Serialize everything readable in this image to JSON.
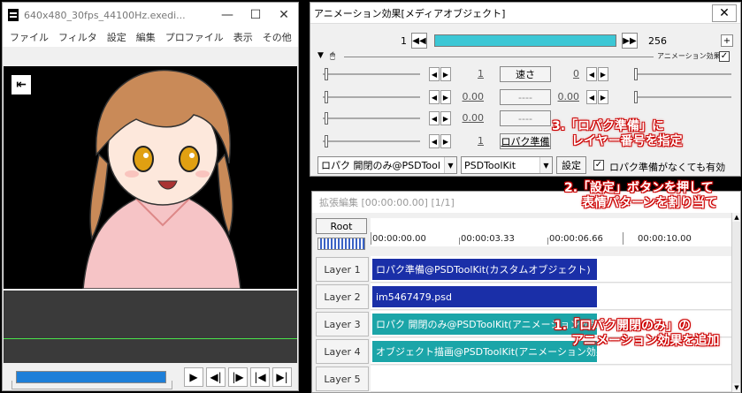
{
  "left_window": {
    "title": "640x480_30fps_44100Hz.exedi...",
    "menu": [
      "ファイル",
      "フィルタ",
      "設定",
      "編集",
      "プロファイル",
      "表示",
      "その他"
    ]
  },
  "anim_window": {
    "title": "アニメーション効果[メディアオブジェクト]",
    "frame_start": "1",
    "frame_end": "256",
    "anim_label": "アニメーション効果",
    "rows": [
      {
        "left_val": "1",
        "button": "速さ",
        "right_val": "0",
        "disabled": false
      },
      {
        "left_val": "0.00",
        "button": "----",
        "right_val": "0.00",
        "disabled": true
      },
      {
        "left_val": "0.00",
        "button": "----",
        "right_val": "",
        "disabled": true
      },
      {
        "left_val": "1",
        "button": "ロパク準備",
        "right_val": "",
        "disabled": false
      }
    ],
    "effect_select": "ロパク 開閉のみ@PSDTool",
    "group_select": "PSDToolKit",
    "settings_button": "設定",
    "checkbox_label": "ロパク準備がなくても有効"
  },
  "timeline": {
    "title": "拡張編集 [00:00:00.00] [1/1]",
    "root": "Root",
    "ruler_labels": [
      "00:00:00.00",
      "00:00:03.33",
      "00:00:06.66",
      "00:00:10.00"
    ],
    "layers": [
      "Layer 1",
      "Layer 2",
      "Layer 3",
      "Layer 4",
      "Layer 5"
    ],
    "clips": [
      {
        "label": "ロパク準備@PSDToolKit(カスタムオブジェクト)",
        "color": "#1a2fa8"
      },
      {
        "label": "im5467479.psd",
        "color": "#1a2fa8"
      },
      {
        "label": "ロパク 開閉のみ@PSDToolKit(アニメーション効果)",
        "color": "#1ba5a8"
      },
      {
        "label": "オブジェクト描画@PSDToolKit(アニメーション効果)",
        "color": "#1ba5a8"
      }
    ]
  },
  "annotations": {
    "a3_line1": "3.「ロパク準備」に",
    "a3_line2": "レイヤー番号を指定",
    "a2_line1": "2.「設定」ボタンを押して",
    "a2_line2": "表情パターンを割り当て",
    "a1_line1": "1.「ロパク開閉のみ」の",
    "a1_line2": "アニメーション効果を追加"
  }
}
